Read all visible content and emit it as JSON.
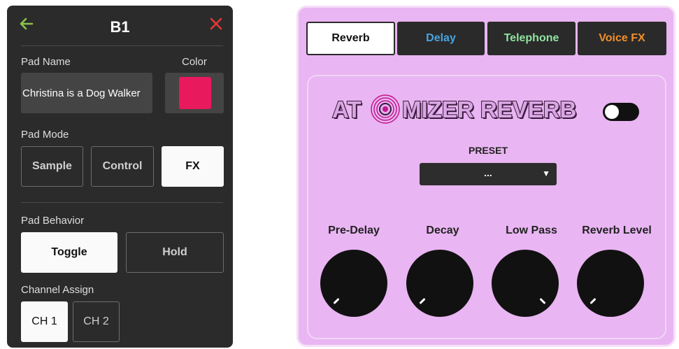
{
  "pad_editor": {
    "title": "B1",
    "back_icon": "arrow-left-icon",
    "close_icon": "close-icon",
    "accent_color": "#8bc34a",
    "close_color": "#e53935",
    "pad_name_label": "Pad Name",
    "pad_name_value": "Christina is a Dog Walker",
    "color_label": "Color",
    "color_value": "#e8195c",
    "pad_mode_label": "Pad Mode",
    "pad_mode_options": [
      "Sample",
      "Control",
      "FX"
    ],
    "pad_mode_selected": "FX",
    "pad_behavior_label": "Pad Behavior",
    "pad_behavior_options": [
      "Toggle",
      "Hold"
    ],
    "pad_behavior_selected": "Toggle",
    "channel_assign_label": "Channel Assign",
    "channel_options": [
      "CH 1",
      "CH 2"
    ],
    "channel_selected": "CH 1"
  },
  "fx_panel": {
    "tabs": [
      {
        "label": "Reverb",
        "color": "#111111",
        "active": true
      },
      {
        "label": "Delay",
        "color": "#4aa3e0",
        "active": false
      },
      {
        "label": "Telephone",
        "color": "#8fe3a0",
        "active": false
      },
      {
        "label": "Voice FX",
        "color": "#f0902a",
        "active": false
      }
    ],
    "logo_text_left": "AT",
    "logo_text_right": "MIZER REVERB",
    "logo_icon": "target-icon",
    "enabled": false,
    "preset_label": "PRESET",
    "preset_value": "...",
    "preset_caret_icon": "caret-down-icon",
    "knobs": [
      {
        "label": "Pre-Delay",
        "value": 0.0
      },
      {
        "label": "Decay",
        "value": 0.0
      },
      {
        "label": "Low Pass",
        "value": 1.0
      },
      {
        "label": "Reverb Level",
        "value": 0.0
      }
    ]
  }
}
